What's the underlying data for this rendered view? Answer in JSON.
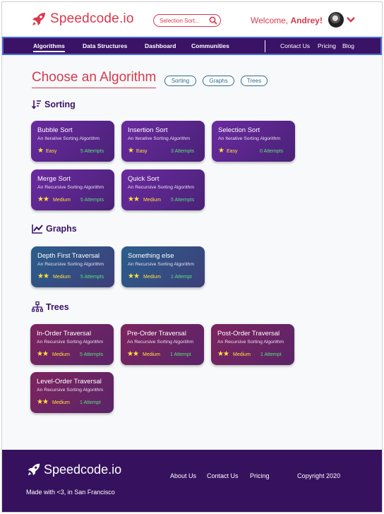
{
  "header": {
    "logo_text": "Speedcode.io",
    "search_placeholder": "Selection Sort...",
    "welcome_prefix": "Welcome, ",
    "user_name": "Andrey!"
  },
  "nav": {
    "left": [
      "Algorithms",
      "Data Structures",
      "Dashboard",
      "Communities"
    ],
    "right": [
      "Contact Us",
      "Pricing",
      "Blog"
    ],
    "active": "Algorithms"
  },
  "main": {
    "title": "Choose an Algorithm",
    "filters": [
      "Sorting",
      "Graphs",
      "Trees"
    ],
    "sections": [
      {
        "label": "Sorting",
        "icon": "sort-icon",
        "cards": [
          {
            "title": "Bubble Sort",
            "subtitle": "An Iterative Sorting Algorithm",
            "stars": "★",
            "difficulty": "Easy",
            "attempts": "5 Attempts"
          },
          {
            "title": "Insertion Sort",
            "subtitle": "An Iterative Sorting Algorithm",
            "stars": "★",
            "difficulty": "Easy",
            "attempts": "3 Attempts"
          },
          {
            "title": "Selection Sort",
            "subtitle": "An Iterative Sorting Algorithm",
            "stars": "★",
            "difficulty": "Easy",
            "attempts": "0 Attempts"
          },
          {
            "title": "Merge Sort",
            "subtitle": "An Recursive Sorting Algorithm",
            "stars": "★★",
            "difficulty": "Medium",
            "attempts": "5 Attempts"
          },
          {
            "title": "Quick Sort",
            "subtitle": "An Recursive Sorting Algorithm",
            "stars": "★★",
            "difficulty": "Medium",
            "attempts": "5 Attempts"
          }
        ]
      },
      {
        "label": "Graphs",
        "icon": "line-chart-icon",
        "cards": [
          {
            "title": "Depth First Traversal",
            "subtitle": "An Recursive Sorting Algorithm",
            "stars": "★★",
            "difficulty": "Medium",
            "attempts": "5 Attempts"
          },
          {
            "title": "Something else",
            "subtitle": "An Recursive Sorting Algorithm",
            "stars": "★★",
            "difficulty": "Medium",
            "attempts": "1 Attempt"
          }
        ]
      },
      {
        "label": "Trees",
        "icon": "tree-icon",
        "cards": [
          {
            "title": "In-Order Traversal",
            "subtitle": "An Recursive Sorting Algorithm",
            "stars": "★★",
            "difficulty": "Medium",
            "attempts": "5 Attempts"
          },
          {
            "title": "Pre-Order Traversal",
            "subtitle": "An Recursive Sorting Algorithm",
            "stars": "★★",
            "difficulty": "Medium",
            "attempts": "1 Attempt"
          },
          {
            "title": "Post-Order Traversal",
            "subtitle": "An Recursive Sorting Algorithm",
            "stars": "★★",
            "difficulty": "Medium",
            "attempts": "1 Attempt"
          },
          {
            "title": "Level-Order Traversal",
            "subtitle": "An Recursive Sorting Algorithm",
            "stars": "★★",
            "difficulty": "Medium",
            "attempts": "1 Attempt"
          }
        ]
      }
    ]
  },
  "footer": {
    "logo_text": "Speedcode.io",
    "tagline": "Made with <3, in San Francisco",
    "links": [
      "About Us",
      "Contact Us",
      "Pricing"
    ],
    "copyright": "Copyright 2020"
  },
  "colors": {
    "brand": "#d9394c",
    "nav_bg": "#3a1266",
    "sorting_card": "#5b2790",
    "graphs_card": "#2f5487",
    "trees_card": "#6c2465",
    "stars": "#ffe23b",
    "attempts": "#57e07a"
  }
}
